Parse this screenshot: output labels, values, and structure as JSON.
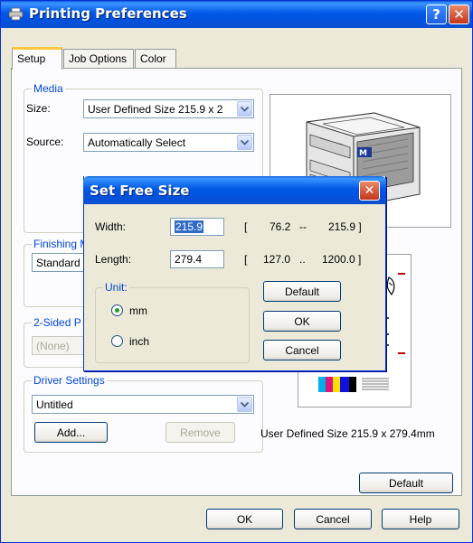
{
  "window": {
    "title": "Printing Preferences",
    "help_button": "?",
    "close_button": "✕"
  },
  "tabs": [
    "Setup",
    "Job Options",
    "Color"
  ],
  "media": {
    "group_label": "Media",
    "size_label": "Size:",
    "size_value": "User Defined Size 215.9 x 2",
    "source_label": "Source:",
    "source_value": "Automatically Select"
  },
  "finishing": {
    "group_label": "Finishing M",
    "value": "Standard"
  },
  "two_sided": {
    "group_label": "2-Sided P",
    "value": "(None)"
  },
  "driver_settings": {
    "group_label": "Driver Settings",
    "value": "Untitled",
    "add_button": "Add...",
    "remove_button": "Remove"
  },
  "preview": {
    "printer_badge": "M",
    "caption": "User Defined Size 215.9 x 279.4mm"
  },
  "default_button": "Default",
  "footer": {
    "ok": "OK",
    "cancel": "Cancel",
    "help": "Help"
  },
  "dialog": {
    "title": "Set Free Size",
    "close": "✕",
    "width_label": "Width:",
    "width_value": "215.9",
    "width_bracket_open": "[",
    "width_min": "76.2",
    "width_sep": "--",
    "width_max": "215.9 ]",
    "length_label": "Length:",
    "length_value": "279.4",
    "length_bracket_open": "[",
    "length_min": "127.0",
    "length_sep": "..",
    "length_max": "1200.0 ]",
    "unit_label": "Unit:",
    "unit_mm": "mm",
    "unit_inch": "inch",
    "default_button": "Default",
    "ok_button": "OK",
    "cancel_button": "Cancel"
  },
  "colors": {
    "titlebar": "#0054E3",
    "group_label": "#0046D5",
    "selection": "#316AC5"
  }
}
